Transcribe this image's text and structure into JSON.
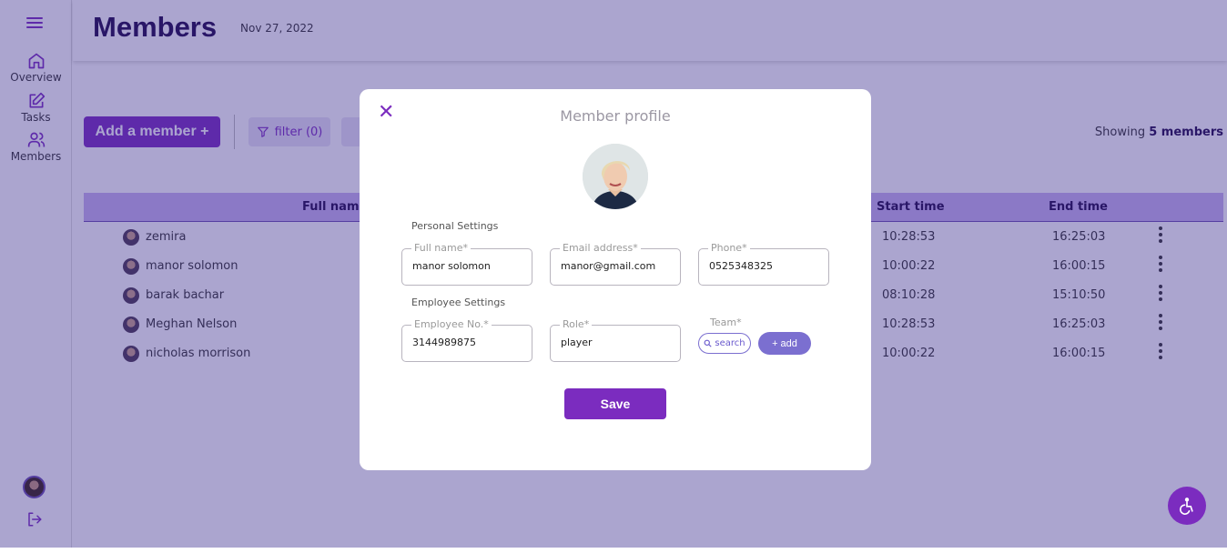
{
  "sidebar": {
    "items": [
      {
        "label": "Overview"
      },
      {
        "label": "Tasks"
      },
      {
        "label": "Members"
      }
    ]
  },
  "header": {
    "title": "Members",
    "date": "Nov 27, 2022"
  },
  "toolbar": {
    "add_label": "Add a member +",
    "filter_label": "filter (0)",
    "showing_prefix": "Showing",
    "showing_count": "5 members"
  },
  "table": {
    "columns": {
      "full_name": "Full name",
      "start_time": "Start time",
      "end_time": "End time"
    },
    "rows": [
      {
        "name": "zemira",
        "start": "10:28:53",
        "end": "16:25:03"
      },
      {
        "name": "manor solomon",
        "start": "10:00:22",
        "end": "16:00:15"
      },
      {
        "name": "barak bachar",
        "start": "08:10:28",
        "end": "15:10:50"
      },
      {
        "name": "Meghan Nelson",
        "start": "10:28:53",
        "end": "16:25:03"
      },
      {
        "name": "nicholas morrison",
        "start": "10:00:22",
        "end": "16:00:15"
      }
    ]
  },
  "modal": {
    "title": "Member profile",
    "personal_settings": "Personal Settings",
    "employee_settings": "Employee Settings",
    "fields": {
      "full_name": {
        "label": "Full name*",
        "value": "manor solomon"
      },
      "email": {
        "label": "Email address*",
        "value": "manor@gmail.com"
      },
      "phone": {
        "label": "Phone*",
        "value": "0525348325"
      },
      "employee_no": {
        "label": "Employee No.*",
        "value": "3144989875"
      },
      "role": {
        "label": "Role*",
        "value": "player"
      }
    },
    "team_label": "Team*",
    "search_label": "search",
    "add_label": "+ add",
    "save_label": "Save",
    "close_icon": "close-icon"
  },
  "colors": {
    "accent": "#7b2cbf",
    "dark_title": "#1f0a4d",
    "overlay": "#36288c",
    "pill": "#7b6fd0"
  }
}
